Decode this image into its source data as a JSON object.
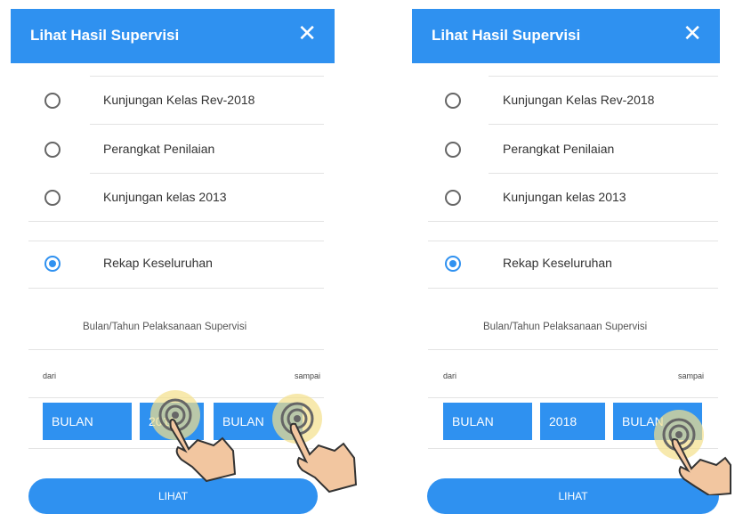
{
  "dialog": {
    "title": "Lihat Hasil Supervisi",
    "close_icon": "close-icon"
  },
  "options": [
    {
      "label": "Kunjungan Kelas Rev-2018",
      "selected": false
    },
    {
      "label": "Perangkat Penilaian",
      "selected": false
    },
    {
      "label": "Kunjungan kelas 2013",
      "selected": false
    },
    {
      "label": "Rekap Keseluruhan",
      "selected": true
    }
  ],
  "period": {
    "heading": "Bulan/Tahun Pelaksanaan Supervisi",
    "from_label": "dari",
    "to_label": "sampai",
    "from_month": "BULAN",
    "from_year": "2018",
    "to_month": "BULAN"
  },
  "submit_label": "LIHAT",
  "colors": {
    "accent": "#2f91f0",
    "touch_highlight": "#f3e08a"
  },
  "icons": [
    "close-icon",
    "radio-button-icon",
    "tap-hand-icon"
  ]
}
